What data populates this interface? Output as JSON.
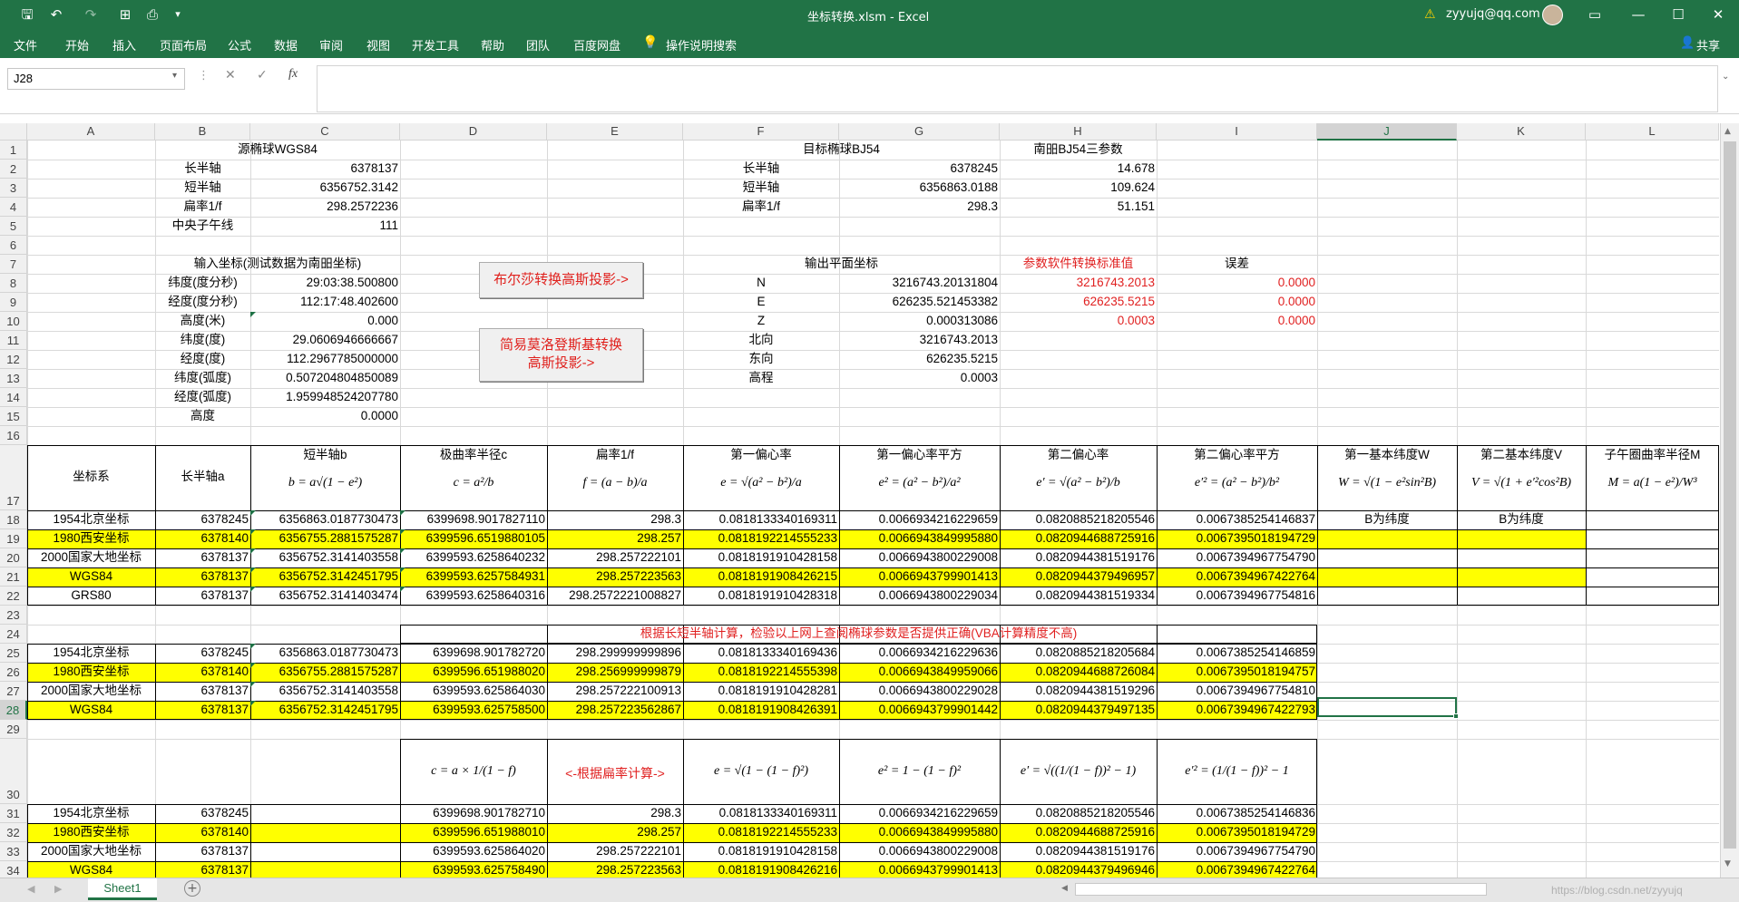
{
  "app": {
    "title": "坐标转换.xlsm  -  Excel",
    "user": "zyyujq@qq.com",
    "share_label": "共享",
    "tell_me": "操作说明搜索"
  },
  "ribbon_tabs": [
    "文件",
    "开始",
    "插入",
    "页面布局",
    "公式",
    "数据",
    "审阅",
    "视图",
    "开发工具",
    "帮助",
    "团队",
    "百度网盘"
  ],
  "formula_bar": {
    "name_box": "J28",
    "content": ""
  },
  "columns": [
    "A",
    "B",
    "C",
    "D",
    "E",
    "F",
    "G",
    "H",
    "I",
    "J",
    "K",
    "L"
  ],
  "rows": [
    "1",
    "2",
    "3",
    "4",
    "5",
    "6",
    "7",
    "8",
    "9",
    "10",
    "11",
    "12",
    "13",
    "14",
    "15",
    "16",
    "17",
    "18",
    "19",
    "20",
    "21",
    "22",
    "23",
    "24",
    "25",
    "26",
    "27",
    "28",
    "29",
    "30",
    "31",
    "32",
    "33",
    "34"
  ],
  "buttons": {
    "bursa": "布尔莎转换高斯投影->",
    "molodensky_1": "简易莫洛登斯基转换",
    "molodensky_2": "高斯投影->"
  },
  "top_left": {
    "title": "源椭球WGS84",
    "rows": [
      {
        "label": "长半轴",
        "value": "6378137"
      },
      {
        "label": "短半轴",
        "value": "6356752.3142"
      },
      {
        "label": "扁率1/f",
        "value": "298.2572236"
      },
      {
        "label": "中央子午线",
        "value": "111"
      }
    ],
    "input_title": "输入坐标(测试数据为南昍坐标)",
    "inputs": [
      {
        "label": "纬度(度分秒)",
        "value": "29:03:38.500800"
      },
      {
        "label": "经度(度分秒)",
        "value": "112:17:48.402600"
      },
      {
        "label": "高度(米)",
        "value": "0.000"
      },
      {
        "label": "纬度(度)",
        "value": "29.0606946666667"
      },
      {
        "label": "经度(度)",
        "value": "112.2967785000000"
      },
      {
        "label": "纬度(弧度)",
        "value": "0.507204804850089"
      },
      {
        "label": "经度(弧度)",
        "value": "1.959948524207780"
      },
      {
        "label": "高度",
        "value": "0.0000"
      }
    ]
  },
  "top_right": {
    "title": "目标椭球BJ54",
    "param_title": "南昍BJ54三参数",
    "rows": [
      {
        "label": "长半轴",
        "value": "6378245",
        "param": "14.678"
      },
      {
        "label": "短半轴",
        "value": "6356863.0188",
        "param": "109.624"
      },
      {
        "label": "扁率1/f",
        "value": "298.3",
        "param": "51.151"
      }
    ],
    "output_title": "输出平面坐标",
    "ref_title": "参数软件转换标准值",
    "err_title": "误差",
    "outputs": [
      {
        "label": "N",
        "value": "3216743.20131804",
        "ref": "3216743.2013",
        "err": "0.0000"
      },
      {
        "label": "E",
        "value": "626235.521453382",
        "ref": "626235.5215",
        "err": "0.0000"
      },
      {
        "label": "Z",
        "value": "0.000313086",
        "ref": "0.0003",
        "err": "0.0000"
      },
      {
        "label": "北向",
        "value": "3216743.2013"
      },
      {
        "label": "东向",
        "value": "626235.5215"
      },
      {
        "label": "高程",
        "value": "0.0003"
      }
    ]
  },
  "table1": {
    "headers": [
      "坐标系",
      "长半轴a",
      "短半轴b",
      "极曲率半径c",
      "扁率1/f",
      "第一偏心率",
      "第一偏心率平方",
      "第二偏心率",
      "第二偏心率平方",
      "第一基本纬度W",
      "第二基本纬度V",
      "子午圈曲率半径M"
    ],
    "formulas": [
      "",
      "",
      "b = a√(1 − e²)",
      "c = a²/b",
      "f = (a − b)/a",
      "e = √(a² − b²)/a",
      "e² = (a² − b²)/a²",
      "e′ = √(a² − b²)/b",
      "e′² = (a² − b²)/b²",
      "W = √(1 − e²sin²B)",
      "V = √(1 + e′²cos²B)",
      "M = a(1 − e²)/W³"
    ],
    "rows": [
      [
        "1954北京坐标",
        "6378245",
        "6356863.0187730473",
        "6399698.9017827110",
        "298.3",
        "0.0818133340169311",
        "0.0066934216229659",
        "0.0820885218205546",
        "0.0067385254146837",
        "B为纬度",
        "B为纬度",
        ""
      ],
      [
        "1980西安坐标",
        "6378140",
        "6356755.2881575287",
        "6399596.6519880105",
        "298.257",
        "0.0818192214555233",
        "0.0066943849995880",
        "0.0820944688725916",
        "0.0067395018194729",
        "",
        "",
        ""
      ],
      [
        "2000国家大地坐标",
        "6378137",
        "6356752.3141403558",
        "6399593.6258640232",
        "298.257222101",
        "0.0818191910428158",
        "0.0066943800229008",
        "0.0820944381519176",
        "0.0067394967754790",
        "",
        "",
        ""
      ],
      [
        "WGS84",
        "6378137",
        "6356752.3142451795",
        "6399593.6257584931",
        "298.257223563",
        "0.0818191908426215",
        "0.0066943799901413",
        "0.0820944379496957",
        "0.0067394967422764",
        "",
        "",
        ""
      ],
      [
        "GRS80",
        "6378137",
        "6356752.3141403474",
        "6399593.6258640316",
        "298.2572221008827",
        "0.0818191910428318",
        "0.0066943800229034",
        "0.0820944381519334",
        "0.0067394967754816",
        "",
        "",
        ""
      ]
    ]
  },
  "table2": {
    "title": "根据长短半轴计算，检验以上网上查阅椭球参数是否提供正确(VBA计算精度不高)",
    "rows": [
      [
        "1954北京坐标",
        "6378245",
        "6356863.0187730473",
        "6399698.901782720",
        "298.299999999896",
        "0.0818133340169436",
        "0.0066934216229636",
        "0.0820885218205684",
        "0.0067385254146859"
      ],
      [
        "1980西安坐标",
        "6378140",
        "6356755.2881575287",
        "6399596.651988020",
        "298.256999999879",
        "0.0818192214555398",
        "0.0066943849959066",
        "0.0820944688726084",
        "0.0067395018194757"
      ],
      [
        "2000国家大地坐标",
        "6378137",
        "6356752.3141403558",
        "6399593.625864030",
        "298.257222100913",
        "0.0818191910428281",
        "0.0066943800229028",
        "0.0820944381519296",
        "0.0067394967754810"
      ],
      [
        "WGS84",
        "6378137",
        "6356752.3142451795",
        "6399593.625758500",
        "298.257223562867",
        "0.0818191908426391",
        "0.0066943799901442",
        "0.0820944379497135",
        "0.0067394967422793"
      ]
    ]
  },
  "table3": {
    "formulas": [
      "c = a × 1/(1 − f)",
      "<-根据扁率计算->",
      "e = √(1 − (1 − f)²)",
      "e² = 1 − (1 − f)²",
      "e′ = √((1/(1 − f))² − 1)",
      "e′² = (1/(1 − f))² − 1"
    ],
    "rows": [
      [
        "1954北京坐标",
        "6378245",
        "6399698.901782710",
        "298.3",
        "0.0818133340169311",
        "0.0066934216229659",
        "0.0820885218205546",
        "0.0067385254146836"
      ],
      [
        "1980西安坐标",
        "6378140",
        "6399596.651988010",
        "298.257",
        "0.0818192214555233",
        "0.0066943849995880",
        "0.0820944688725916",
        "0.0067395018194729"
      ],
      [
        "2000国家大地坐标",
        "6378137",
        "6399593.625864020",
        "298.257222101",
        "0.0818191910428158",
        "0.0066943800229008",
        "0.0820944381519176",
        "0.0067394967754790"
      ],
      [
        "WGS84",
        "6378137",
        "6399593.625758490",
        "298.257223563",
        "0.0818191908426216",
        "0.0066943799901413",
        "0.0820944379496946",
        "0.0067394967422764"
      ]
    ]
  },
  "sheet_tabs": [
    "Sheet1"
  ],
  "watermark": "https://blog.csdn.net/zyyujq",
  "colors": {
    "excel_green": "#217346",
    "highlight": "#ffff00",
    "red": "#e02020"
  }
}
